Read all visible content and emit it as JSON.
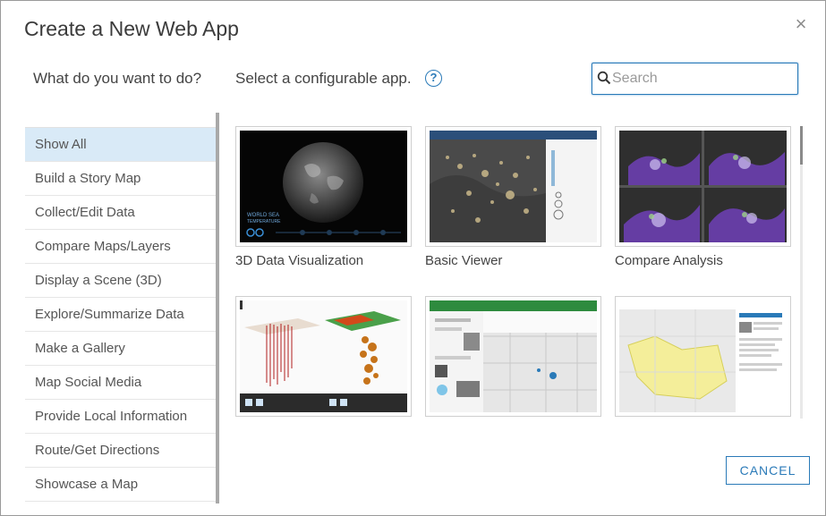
{
  "dialog": {
    "title": "Create a New Web App",
    "close_glyph": "×"
  },
  "sidebar": {
    "question": "What do you want to do?",
    "items": [
      {
        "label": "Show All",
        "active": true
      },
      {
        "label": "Build a Story Map"
      },
      {
        "label": "Collect/Edit Data"
      },
      {
        "label": "Compare Maps/Layers"
      },
      {
        "label": "Display a Scene (3D)"
      },
      {
        "label": "Explore/Summarize Data"
      },
      {
        "label": "Make a Gallery"
      },
      {
        "label": "Map Social Media"
      },
      {
        "label": "Provide Local Information"
      },
      {
        "label": "Route/Get Directions"
      },
      {
        "label": "Showcase a Map"
      }
    ]
  },
  "main": {
    "select_label": "Select a configurable app.",
    "help_glyph": "?",
    "search": {
      "placeholder": "Search",
      "value": ""
    },
    "apps": [
      {
        "label": "3D Data Visualization",
        "thumb_icon": "globe-thumbnail"
      },
      {
        "label": "Basic Viewer",
        "thumb_icon": "dark-map-thumbnail"
      },
      {
        "label": "Compare Analysis",
        "thumb_icon": "four-map-thumbnail"
      },
      {
        "label": "",
        "thumb_icon": "3d-bars-thumbnail"
      },
      {
        "label": "",
        "thumb_icon": "story-map-thumbnail"
      },
      {
        "label": "",
        "thumb_icon": "crowdsource-thumbnail"
      }
    ]
  },
  "footer": {
    "cancel_label": "CANCEL"
  },
  "colors": {
    "accent": "#2a7ab8",
    "active_item_bg": "#d9eaf7"
  }
}
